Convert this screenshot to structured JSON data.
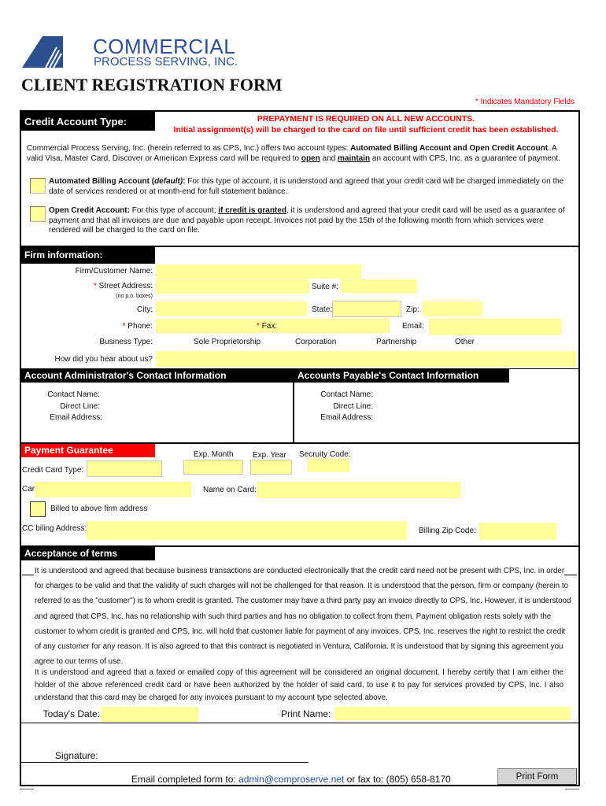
{
  "logo": {
    "line1": "COMMERCIAL",
    "line2": "PROCESS SERVING, INC.",
    "color": "#2b4f8f"
  },
  "title": "CLIENT REGISTRATION FORM",
  "mandatory_note": "* Indicates Mandatory Fields",
  "credit": {
    "header": "Credit Account Type:",
    "notice1": "PREPAYMENT IS REQUIRED ON ALL NEW ACCOUNTS.",
    "notice2": "Initial assignment(s) will be charged to the card on file until sufficient credit has been established.",
    "intro_a": "Commercial Process Serving, Inc. (herein referred to as CPS, Inc.) offers two account types: ",
    "intro_b": "Automated Billing Account and Open Credit Account",
    "intro_c": ". A valid Visa, Master Card, Discover or American Express card will be required to ",
    "intro_open": "open",
    "intro_and": " and ",
    "intro_maintain": "maintain",
    "intro_d": " an account with CPS, Inc. as a guarantee of payment.",
    "auto_title": "Automated Billing Account (",
    "auto_default": "default)",
    "auto_colon": ":",
    "auto_text": " For this type of account, it is understood and agreed that your credit card will be charged immediately on the date of services rendered or at month-end for full statement balance.",
    "open_title": "Open Credit Account:",
    "open_a": " For this type of account; ",
    "open_granted": "if credit is granted",
    "open_b": ", it is understood and agreed that your credit card will be used as a guarantee  of payment and that all invoices are due and payable upon receipt. Invoices not paid by the 15th of the following month from which services were rendered will be charged to the card on file."
  },
  "firm": {
    "header": "Firm information:",
    "name": "Firm/Customer Name:",
    "star": "*",
    "street": " Street Address:",
    "no_po": "(no p.o. boxes)",
    "suite": "Suite #:",
    "city": "City:",
    "state": "State:",
    "zip": "Zip:",
    "phone": " Phone:",
    "fax": " Fax:",
    "email": "Email:",
    "business_type": "Business Type:",
    "types": [
      "Sole Proprietorship",
      "Corporation",
      "Partnership",
      "Other"
    ],
    "hear": "How did you hear about us?"
  },
  "admin": {
    "header": "Account Administrator's Contact Information",
    "contact": "Contact Name:",
    "direct": "Direct Line:",
    "email": "Email Address:"
  },
  "ap": {
    "header": "Accounts Payable's Contact Information",
    "contact": "Contact Name:",
    "direct": "Direct Line:",
    "email": "Email Address:"
  },
  "payment": {
    "header": "Payment Guarantee",
    "header_color": "#ff0000",
    "exp_month": "Exp. Month",
    "exp_year": "Exp. Year",
    "security": "Secruity Code:",
    "card_type": "Credit Card Type:",
    "card_no": "Card #:",
    "name_on_card": "Name on Card:",
    "billed_above": "Billed to above firm address",
    "cc_address": "CC biling Address:",
    "billing_zip": "Billing Zip Code:"
  },
  "terms": {
    "header": "Acceptance of terms",
    "p1": "It is understood and agreed that because business transactions are conducted electronically that the credit card need not be present with CPS, Inc. in order for charges to be valid and that the validity of such charges will not be challenged for that reason. It is understood that the person, firm or company (herein to referred to as the \"customer\") is to whom credit is granted. The customer may have a third party pay an invoice directly to CPS, Inc. However, it is understood and agreed that CPS, Inc. has no relationship with such third parties and has no obligation to collect from them. Payment obligation rests solely with the customer to whom credit is granted and CPS, Inc. will hold that customer liable for payment of any invoices. CPS, Inc. reserves the right to restrict the credit of any customer for any reason. It is also agreed to that this contract is negotiated in Ventura,  California. It is understood that by signing this agreement you agree to our terms of use.",
    "p2": "It is understood and agreed that a faxed or emailed copy of this agreement will be considered an original document. I hereby certify that I am either the holder of the above referenced credit card or have been authorized by the holder of said card, to use it to pay for services provided by CPS, Inc. I also understand that this card may be charged for any invoices pursuant to my account type selected above.",
    "date": "Today's Date:",
    "print_name": "Print Name:",
    "signature": "Signature:"
  },
  "footer": {
    "email_prefix": "Email completed form to: ",
    "email": "admin@comproserve.net",
    "fax": " or fax to: (805) 658-8170",
    "print_button": "Print Form"
  },
  "colors": {
    "field": "#ffff99",
    "link": "#1f4e9c"
  }
}
